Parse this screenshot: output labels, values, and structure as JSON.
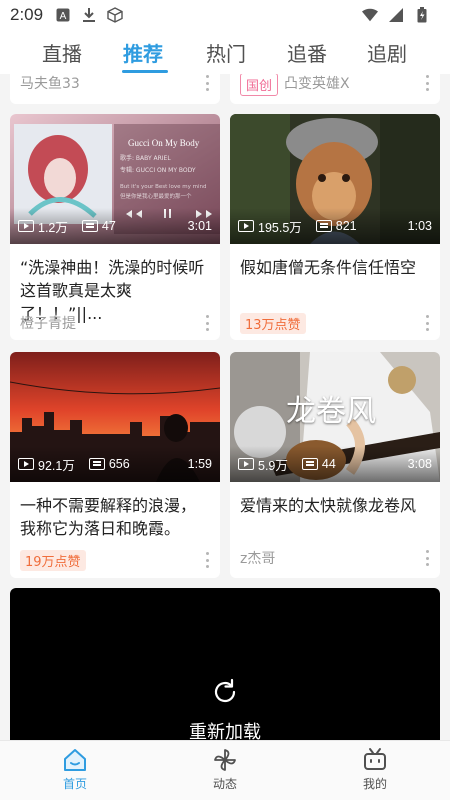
{
  "status_bar": {
    "time": "2:09"
  },
  "tabs": [
    "直播",
    "推荐",
    "热门",
    "追番",
    "追剧"
  ],
  "active_tab": "推荐",
  "top_cards": [
    {
      "author": "马夫鱼33"
    },
    {
      "badge": "国创",
      "author": "凸变英雄X"
    }
  ],
  "cards": [
    {
      "thumb_title": "Gucci On My Body",
      "plays": "1.2万",
      "danmaku": "47",
      "duration": "3:01",
      "title": "“洗澡神曲！洗澡的时候听这首歌真是太爽了！！”||...",
      "author": "橙子青提"
    },
    {
      "plays": "195.5万",
      "danmaku": "821",
      "duration": "1:03",
      "title": "假如唐僧无条件信任悟空",
      "likes": "13万点赞"
    },
    {
      "plays": "92.1万",
      "danmaku": "656",
      "duration": "1:59",
      "title": "一种不需要解释的浪漫，我称它为落日和晚霞。",
      "likes": "19万点赞"
    },
    {
      "thumb_title": "龙卷风",
      "plays": "5.9万",
      "danmaku": "44",
      "duration": "3:08",
      "title": "爱情来的太快就像龙卷风",
      "author": "z杰哥"
    }
  ],
  "video_card": {
    "reload_label": "重新加载"
  },
  "bottom_nav": [
    {
      "label": "首页"
    },
    {
      "label": "动态"
    },
    {
      "label": "我的"
    }
  ],
  "colors": {
    "accent": "#2f9ce0",
    "like_text": "#f06d3b",
    "like_bg": "#fde9e2",
    "origin_badge": "#f06b94"
  }
}
